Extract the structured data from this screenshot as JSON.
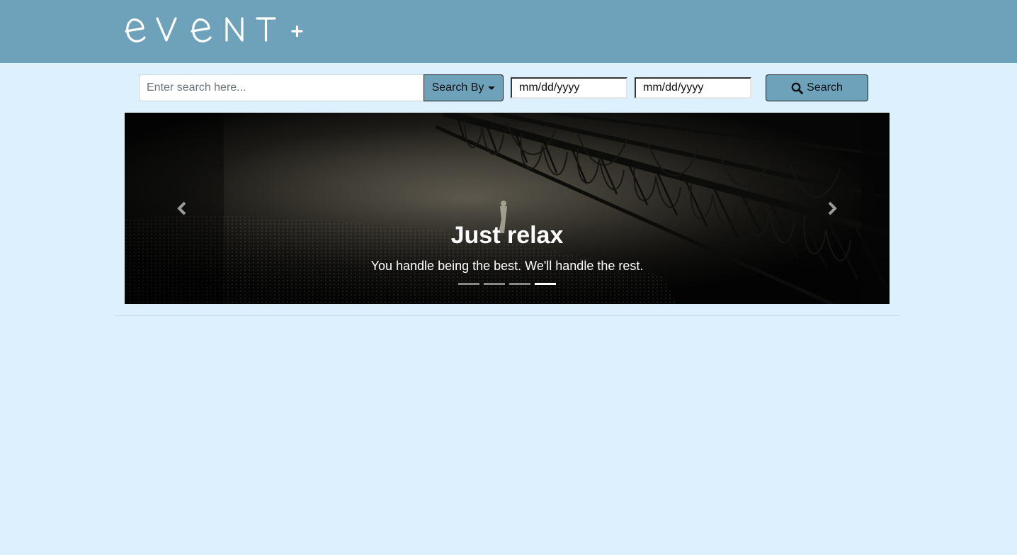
{
  "header": {
    "logo_text": "event+",
    "colors": {
      "bar": "#6ea2ba",
      "page_bg": "#ddf0fd"
    }
  },
  "search": {
    "placeholder": "Enter search here...",
    "search_by_label": "Search By",
    "date_from": "mm/dd/yyyy",
    "date_to": "mm/dd/yyyy",
    "search_button_label": "Search",
    "search_icon": "search-icon"
  },
  "carousel": {
    "slide_title": "Just relax",
    "slide_subtitle": "You handle being the best. We'll handle the rest.",
    "slide_count": 4,
    "active_index": 4,
    "prev_icon": "chevron-left-icon",
    "next_icon": "chevron-right-icon"
  }
}
